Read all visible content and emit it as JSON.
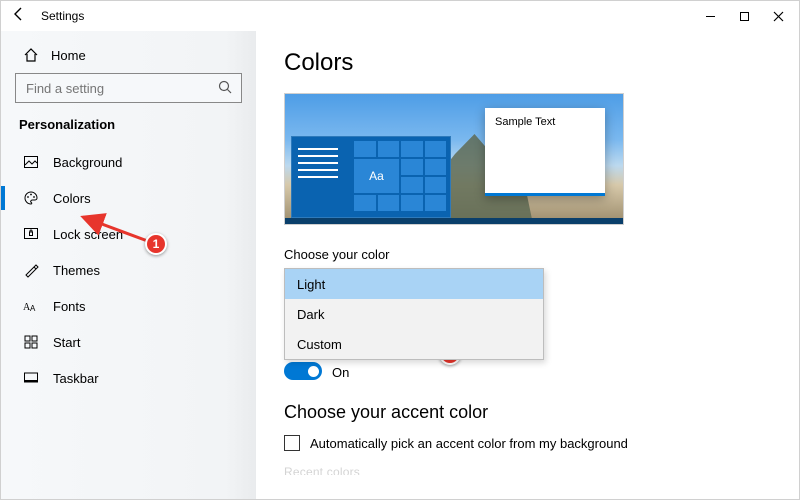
{
  "window": {
    "title": "Settings"
  },
  "sidebar": {
    "home_label": "Home",
    "search_placeholder": "Find a setting",
    "section_title": "Personalization",
    "items": [
      {
        "label": "Background"
      },
      {
        "label": "Colors"
      },
      {
        "label": "Lock screen"
      },
      {
        "label": "Themes"
      },
      {
        "label": "Fonts"
      },
      {
        "label": "Start"
      },
      {
        "label": "Taskbar"
      }
    ]
  },
  "main": {
    "title": "Colors",
    "preview_sample_text": "Sample Text",
    "preview_tile_text": "Aa",
    "choose_color_label": "Choose your color",
    "color_options": [
      "Light",
      "Dark",
      "Custom"
    ],
    "toggle_partial_label": "On",
    "accent_section_title": "Choose your accent color",
    "auto_pick_label": "Automatically pick an accent color from my background",
    "cutoff_text": "Recent colors"
  },
  "annotations": {
    "badge1": "1",
    "badge2": "2"
  }
}
